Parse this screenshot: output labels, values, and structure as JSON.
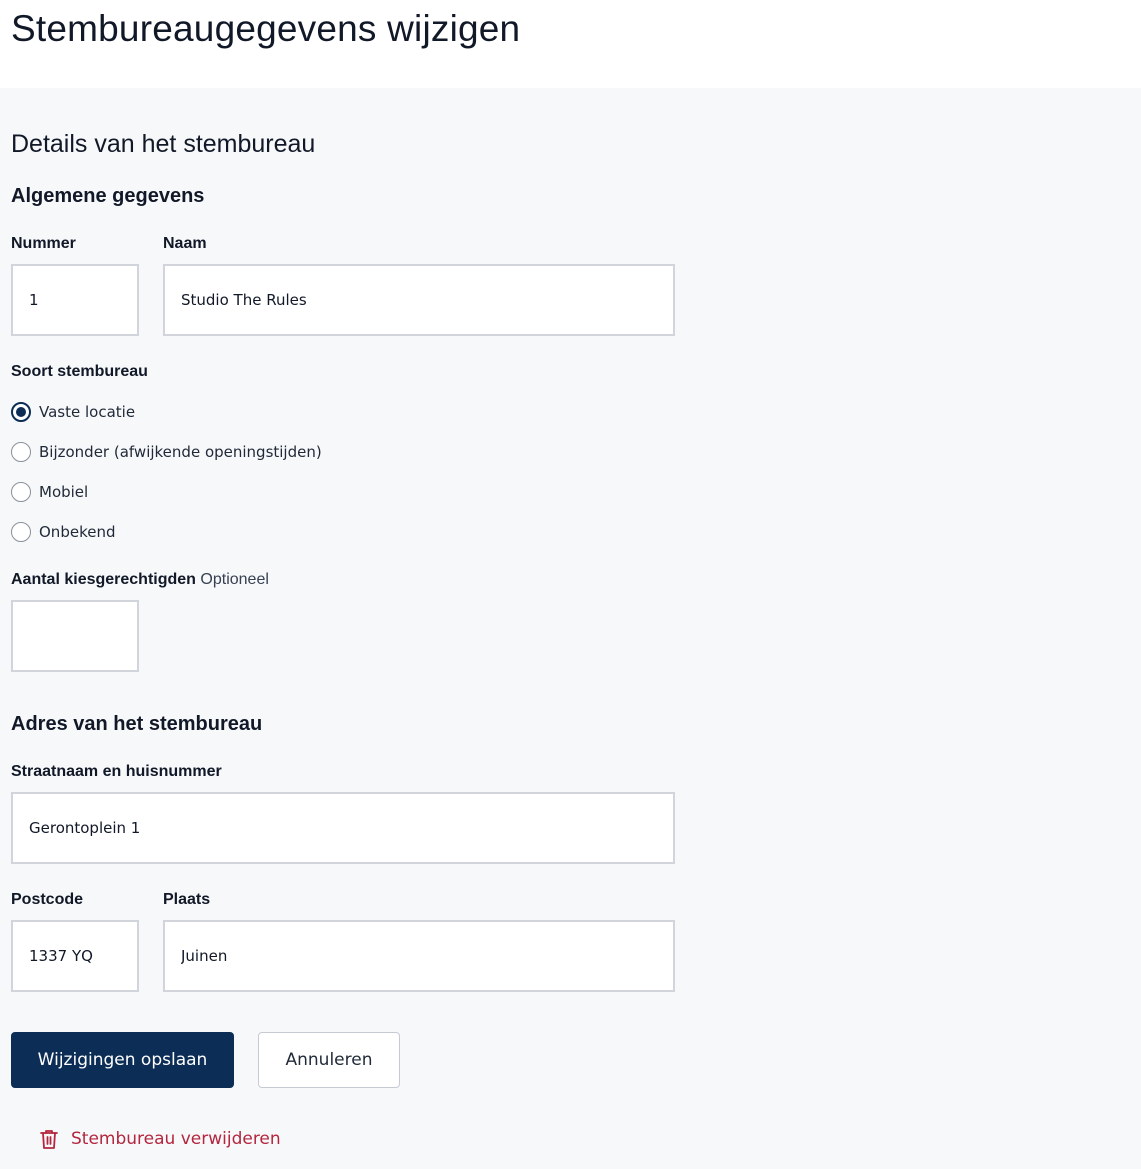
{
  "page": {
    "title": "Stembureaugegevens wijzigen"
  },
  "form": {
    "section_title": "Details van het stembureau",
    "general": {
      "title": "Algemene gegevens",
      "number_label": "Nummer",
      "number_value": "1",
      "name_label": "Naam",
      "name_value": "Studio The Rules"
    },
    "type": {
      "label": "Soort stembureau",
      "options": [
        {
          "label": "Vaste locatie",
          "checked": true
        },
        {
          "label": "Bijzonder (afwijkende openingstijden)",
          "checked": false
        },
        {
          "label": "Mobiel",
          "checked": false
        },
        {
          "label": "Onbekend",
          "checked": false
        }
      ]
    },
    "voters": {
      "label": "Aantal kiesgerechtigden",
      "optional": "Optioneel",
      "value": ""
    },
    "address": {
      "title": "Adres van het stembureau",
      "street_label": "Straatnaam en huisnummer",
      "street_value": "Gerontoplein 1",
      "postcode_label": "Postcode",
      "postcode_value": "1337 YQ",
      "city_label": "Plaats",
      "city_value": "Juinen"
    },
    "actions": {
      "save_label": "Wijzigingen opslaan",
      "cancel_label": "Annuleren",
      "delete_label": "Stembureau verwijderen"
    }
  },
  "colors": {
    "primary": "#0c2d55",
    "danger": "#b3263e",
    "background": "#f7f8fa"
  }
}
